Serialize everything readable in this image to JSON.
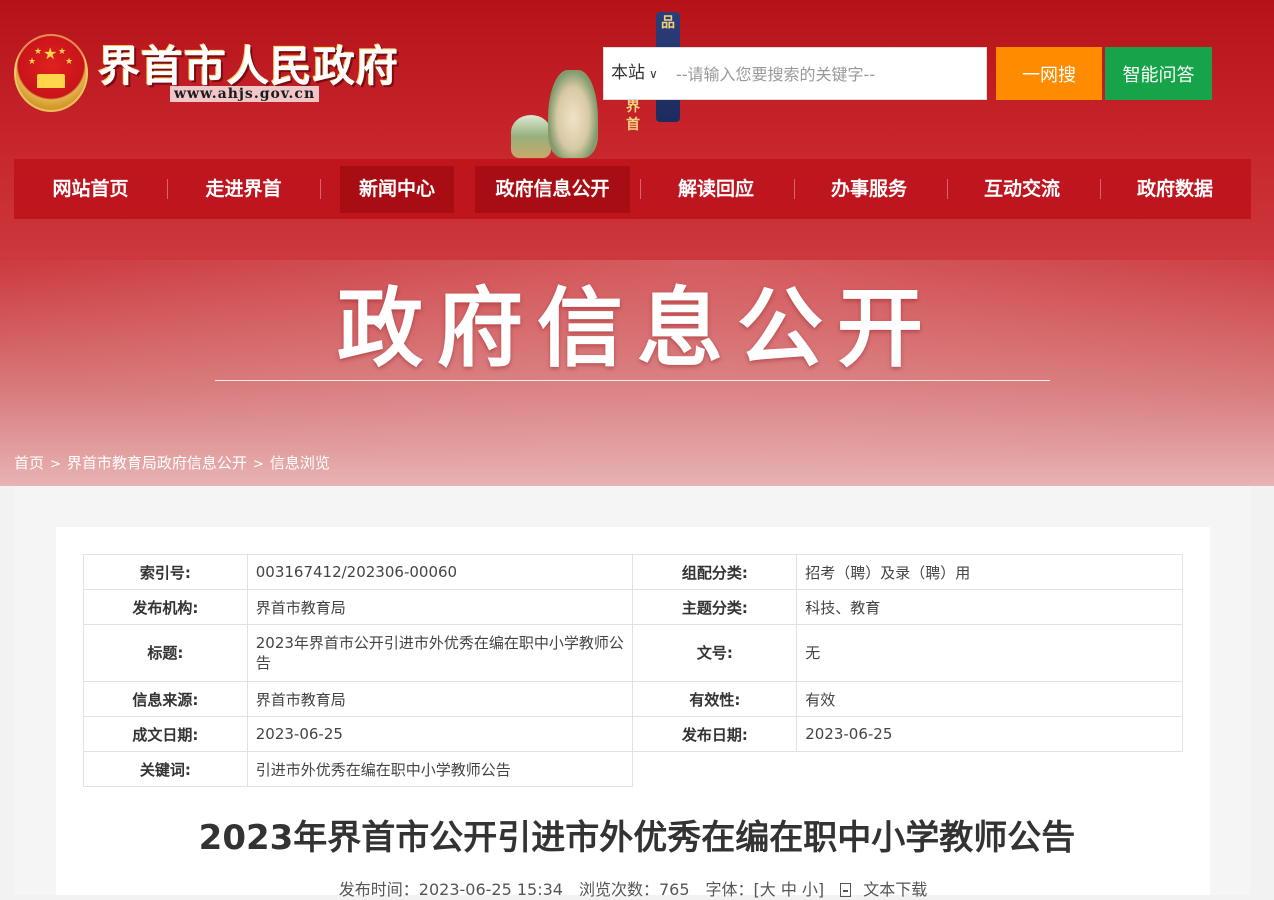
{
  "header": {
    "site_name": "界首市人民政府",
    "site_url": "www.ahjs.gov.cn",
    "deco_text_top": "品",
    "deco_text_side": "界首"
  },
  "search": {
    "scope": "本站",
    "placeholder": "--请输入您要搜索的关键字--",
    "search_button": "一网搜",
    "ai_button": "智能问答"
  },
  "nav": {
    "items": [
      "网站首页",
      "走进界首",
      "新闻中心",
      "政府信息公开",
      "解读回应",
      "办事服务",
      "互动交流",
      "政府数据"
    ]
  },
  "hero": {
    "title": "政府信息公开"
  },
  "breadcrumb": {
    "items": [
      "首页",
      "界首市教育局政府信息公开",
      "信息浏览"
    ],
    "separator": ">"
  },
  "meta": {
    "index_no_label": "索引号:",
    "index_no": "003167412/202306-00060",
    "category_label": "组配分类:",
    "category": "招考（聘）及录（聘）用",
    "publisher_label": "发布机构:",
    "publisher": "界首市教育局",
    "topic_label": "主题分类:",
    "topic": "科技、教育",
    "title_label": "标题:",
    "title": "2023年界首市公开引进市外优秀在编在职中小学教师公告",
    "doc_no_label": "文号:",
    "doc_no": "无",
    "source_label": "信息来源:",
    "source": "界首市教育局",
    "validity_label": "有效性:",
    "validity": "有效",
    "written_date_label": "成文日期:",
    "written_date": "2023-06-25",
    "publish_date_label": "发布日期:",
    "publish_date": "2023-06-25",
    "keywords_label": "关键词:",
    "keywords": "引进市外优秀在编在职中小学教师公告"
  },
  "article": {
    "title": "2023年界首市公开引进市外优秀在编在职中小学教师公告",
    "publish_time": "发布时间：2023-06-25 15:34",
    "views": "浏览次数：765",
    "font_size": "字体：[大 中 小]",
    "download": "文本下载"
  }
}
